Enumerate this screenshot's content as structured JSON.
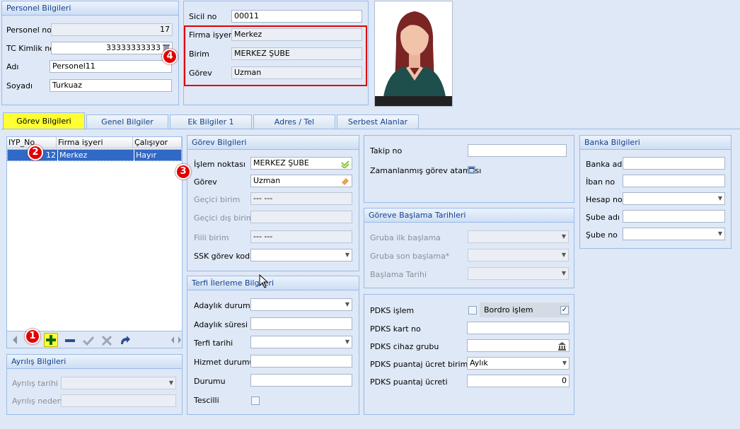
{
  "personel": {
    "title": "Personel Bilgileri",
    "no_label": "Personel no",
    "no_value": "17",
    "tc_label": "TC Kimlik no",
    "tc_value": "33333333333",
    "adi_label": "Adı",
    "adi_value": "Personel11",
    "soyadi_label": "Soyadı",
    "soyadi_value": "Turkuaz"
  },
  "sicil": {
    "sicil_label": "Sicil no",
    "sicil_value": "00011",
    "firma_label": "Firma işyeri",
    "firma_value": "Merkez",
    "birim_label": "Birim",
    "birim_value": "MERKEZ ŞUBE",
    "gorev_label": "Görev",
    "gorev_value": "Uzman"
  },
  "badges": {
    "b1": "1",
    "b2": "2",
    "b3": "3",
    "b4": "4"
  },
  "tabs": [
    {
      "label": "Görev Bilgileri"
    },
    {
      "label": "Genel Bilgiler"
    },
    {
      "label": "Ek Bilgiler 1"
    },
    {
      "label": "Adres / Tel"
    },
    {
      "label": "Serbest Alanlar"
    }
  ],
  "grid": {
    "columns": [
      "IYP_No",
      "Firma işyeri",
      "Çalışıyor"
    ],
    "row": {
      "iyp": "12",
      "firma": "Merkez",
      "calisiyor": "Hayır"
    }
  },
  "ayrilis": {
    "title": "Ayrılış Bilgileri",
    "tarih_label": "Ayrılış tarihi",
    "neden_label": "Ayrılış nedeni"
  },
  "gorev_bilgileri": {
    "title": "Görev Bilgileri",
    "islem_label": "İşlem noktası",
    "islem_value": "MERKEZ ŞUBE",
    "gorev_label": "Görev",
    "gorev_value": "Uzman",
    "gecici_label": "Geçici birim",
    "gecici_value": "--- ---",
    "gecici_dis_label": "Geçici dış birim",
    "gecici_dis_value": "",
    "fiili_label": "Fiili birim",
    "fiili_value": "--- ---",
    "ssk_label": "SSK görev kodu"
  },
  "terfi": {
    "title": "Terfi İlerleme Bilgileri",
    "adaylik_durumu_label": "Adaylık durumu",
    "adaylik_suresi_label": "Adaylık süresi",
    "terfi_tarihi_label": "Terfi tarihi",
    "hizmet_label": "Hizmet durumu",
    "durumu_label": "Durumu",
    "tescilli_label": "Tescilli"
  },
  "takip": {
    "takip_label": "Takip no",
    "zaman_label": "Zamanlanmış görev ataması"
  },
  "baslama": {
    "title": "Göreve Başlama Tarihleri",
    "ilk_label": "Gruba ilk başlama",
    "son_label": "Gruba son başlama*",
    "tarih_label": "Başlama Tarihi"
  },
  "pdks": {
    "islem_label": "PDKS işlem",
    "bordro_label": "Bordro işlem",
    "kart_label": "PDKS kart no",
    "cihaz_label": "PDKS cihaz grubu",
    "birim_label": "PDKS puantaj ücret birimi",
    "birim_value": "Aylık",
    "ucret_label": "PDKS puantaj ücreti",
    "ucret_value": "0"
  },
  "banka": {
    "title": "Banka Bilgileri",
    "adi_label": "Banka adı",
    "iban_label": "İban no",
    "hesap_label": "Hesap no",
    "sube_adi_label": "Şube adı",
    "sube_no_label": "Şube no"
  },
  "icons": {
    "nav_prev": "chevron-left-icon",
    "add": "plus-icon",
    "remove": "minus-icon",
    "confirm": "check-icon",
    "cancel": "x-icon",
    "refresh": "redo-icon",
    "dropdown": "chevron-down-icon"
  },
  "colors": {
    "highlight_red": "#e00000",
    "active_tab": "#ffff33",
    "grid_selection": "#3169c6",
    "panel_bg": "#dfe8f6"
  }
}
